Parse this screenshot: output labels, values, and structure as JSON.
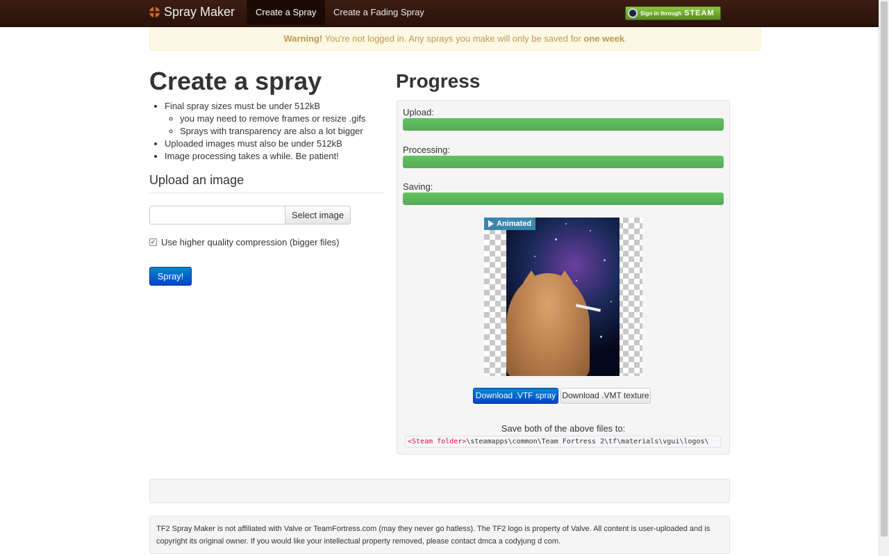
{
  "navbar": {
    "brand": "Spray Maker",
    "items": [
      {
        "label": "Create a Spray",
        "active": true
      },
      {
        "label": "Create a Fading Spray",
        "active": false
      }
    ],
    "steam_button": {
      "small_text": "Sign in through",
      "big_text": "STEAM"
    }
  },
  "warning": {
    "prefix": "Warning!",
    "message": "You're not logged in. Any sprays you make will only be saved for",
    "emphasis": "one week",
    "suffix": "."
  },
  "left": {
    "title": "Create a spray",
    "rules": [
      "Final spray sizes must be under 512kB",
      "you may need to remove frames or resize .gifs",
      "Sprays with transparency are also a lot bigger",
      "Uploaded images must also be under 512kB",
      "Image processing takes a while. Be patient!"
    ],
    "upload_heading": "Upload an image",
    "select_button": "Select image",
    "checkbox_label": "Use higher quality compression (bigger files)",
    "checkbox_checked": true,
    "spray_button": "Spray!"
  },
  "right": {
    "title": "Progress",
    "progress": [
      {
        "label": "Upload:",
        "percent": 100
      },
      {
        "label": "Processing:",
        "percent": 100
      },
      {
        "label": "Saving:",
        "percent": 100
      }
    ],
    "preview_badge": "Animated",
    "download_vtf": "Download .VTF spray",
    "download_vmt": "Download .VMT texture",
    "save_text": "Save both of the above files to:",
    "path_placeholder": "<Steam folder>",
    "path_rest": "\\steamapps\\common\\Team Fortress 2\\tf\\materials\\vgui\\logos\\"
  },
  "footer": {
    "text": "TF2 Spray Maker is not affiliated with Valve or TeamFortress.com (may they never go hatless). The TF2 logo is property of Valve. All content is user-uploaded and is copyright its original owner. If you would like your intellectual property removed, please contact dmca a codyjung d com."
  },
  "colors": {
    "navbar": "#3c1d12",
    "progress_fill": "#5eb95e",
    "primary_button": "#0074cc",
    "warning_bg": "#fcf8e3",
    "warning_text": "#c09853"
  }
}
